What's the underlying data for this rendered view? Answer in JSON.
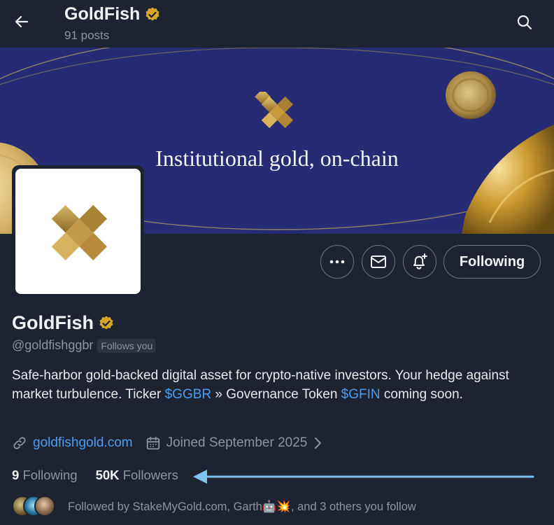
{
  "header": {
    "title": "GoldFish",
    "posts": "91 posts"
  },
  "banner": {
    "tagline": "Institutional gold, on-chain"
  },
  "actions": {
    "following_label": "Following"
  },
  "profile": {
    "name": "GoldFish",
    "handle": "@goldfishggbr",
    "follows_you": "Follows you",
    "bio": {
      "part1": "Safe-harbor gold-backed digital asset for crypto-native investors. Your hedge against market turbulence. Ticker ",
      "ticker1": "$GGBR",
      "part2": " » Governance Token ",
      "ticker2": "$GFIN",
      "part3": " coming soon."
    },
    "website": "goldfishgold.com",
    "joined": "Joined September 2025"
  },
  "stats": {
    "following_count": "9",
    "following_label": "Following",
    "followers_count": "50K",
    "followers_label": "Followers"
  },
  "followed_by": {
    "text": "Followed by StakeMyGold.com, Garth🤖💥, and 3 others you follow"
  },
  "colors": {
    "background": "#1d2330",
    "banner": "#262b74",
    "link": "#4a9ef0",
    "verified": "#d8a72a",
    "annotation_arrow": "#7cc4f0"
  }
}
